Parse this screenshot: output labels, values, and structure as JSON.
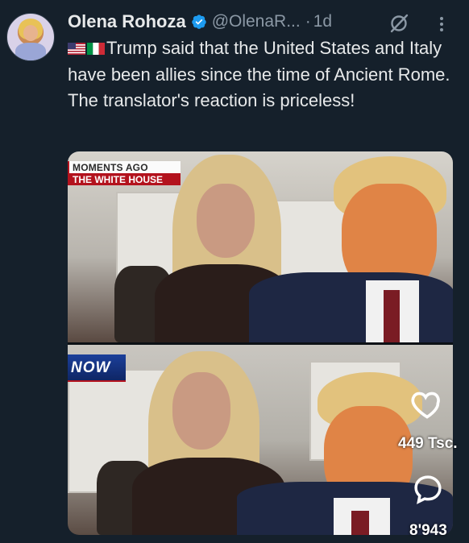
{
  "post": {
    "author_name": "Olena Rohoza",
    "handle": "@OlenaR...",
    "separator": "·",
    "time": "1d",
    "flags": [
      "us-flag-icon",
      "italy-flag-icon"
    ],
    "text": "Trump said that the United States and Italy have been allies since the time of Ancient Rome. The translator's reaction is priceless!"
  },
  "media": {
    "top_banner_line1": "MOMENTS AGO",
    "top_banner_line2": "THE WHITE HOUSE",
    "bottom_logo": "NOW"
  },
  "actions": {
    "like_icon": "heart-icon",
    "like_count": "449 Tsc.",
    "reply_icon": "comment-icon",
    "reply_count": "8'943"
  },
  "colors": {
    "background": "#15202b",
    "verified": "#1d9bf0",
    "secondary_text": "#8b98a5"
  }
}
